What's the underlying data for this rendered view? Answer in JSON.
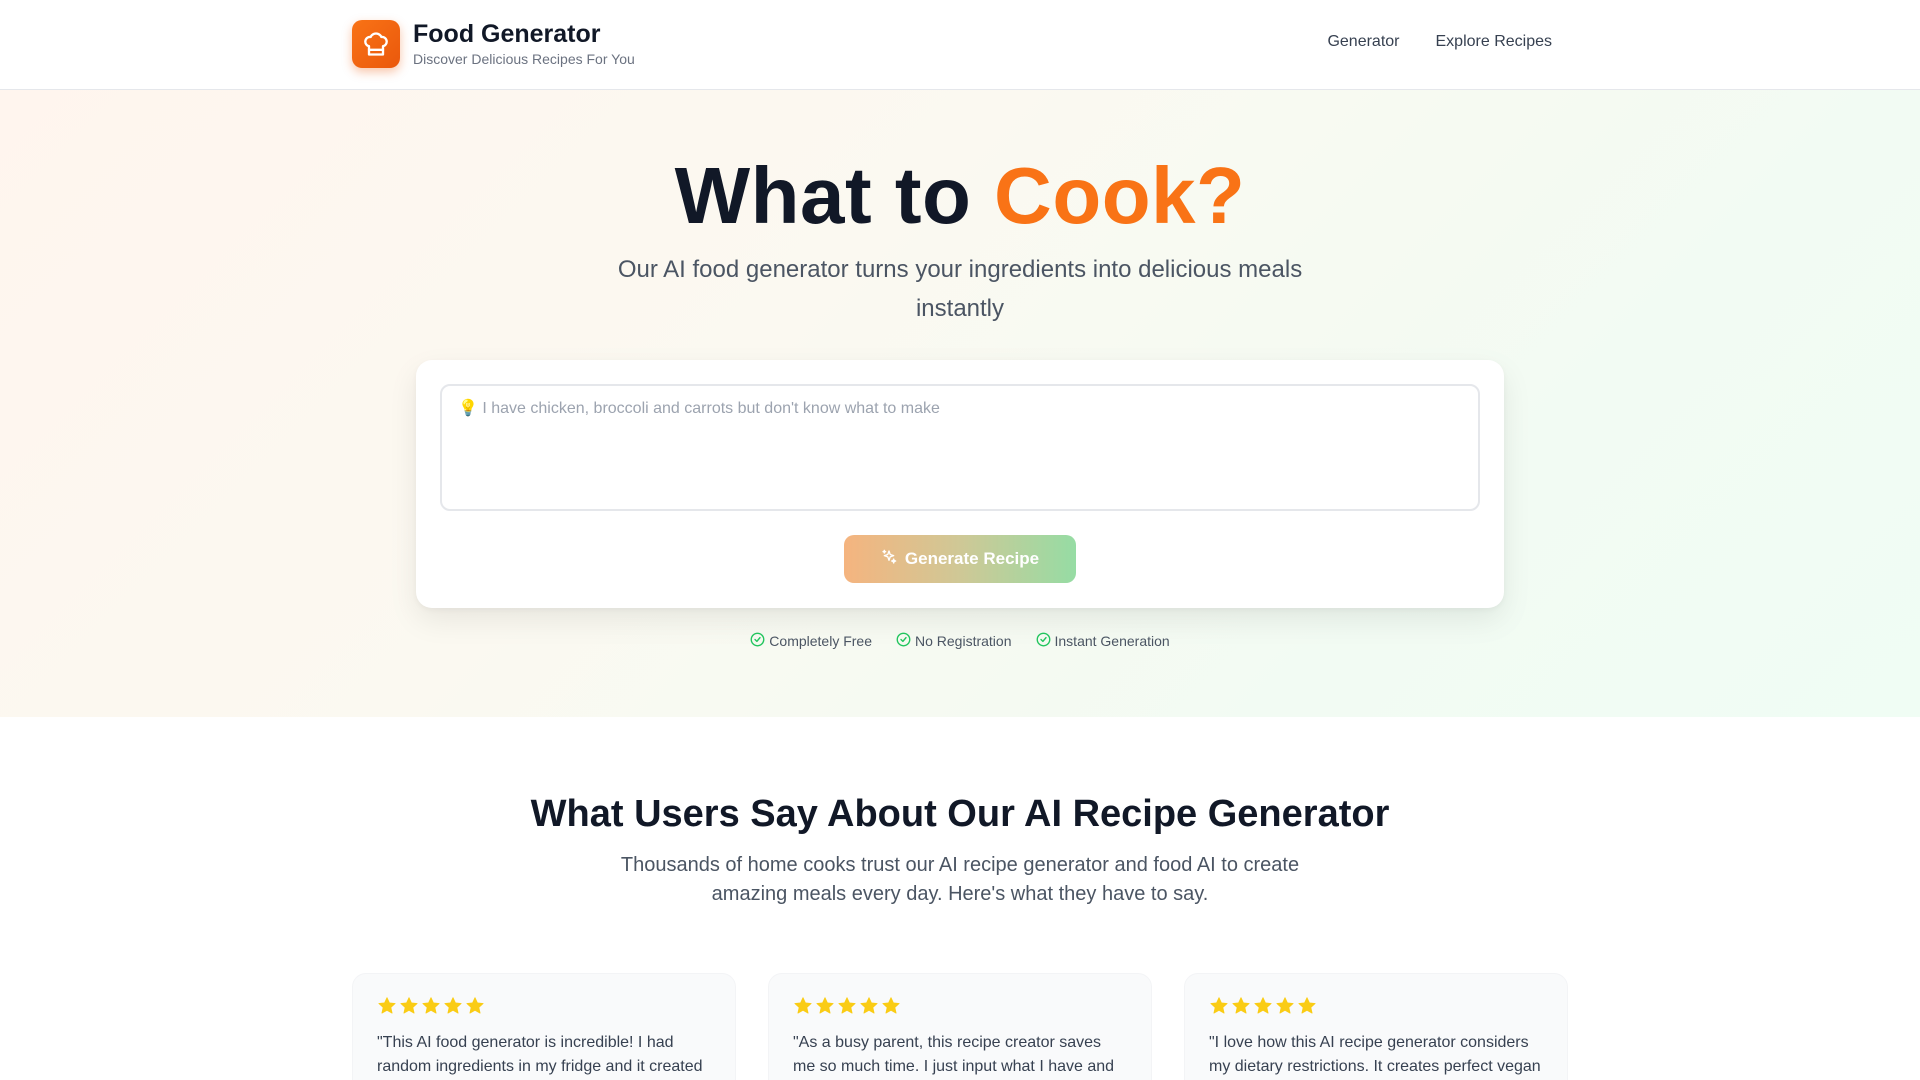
{
  "header": {
    "title": "Food Generator",
    "subtitle": "Discover Delicious Recipes For You",
    "nav": [
      "Generator",
      "Explore Recipes"
    ]
  },
  "hero": {
    "title_part1": "What to ",
    "title_accent": "Cook?",
    "subtitle": "Our AI food generator turns your ingredients into delicious meals instantly",
    "input_placeholder": "💡 I have chicken, broccoli and carrots but don't know what to make",
    "input_value": "",
    "generate_label": "Generate Recipe",
    "features": [
      "Completely Free",
      "No Registration",
      "Instant Generation"
    ]
  },
  "testimonials": {
    "title": "What Users Say About Our AI Recipe Generator",
    "subtitle": "Thousands of home cooks trust our AI recipe generator and food AI to create amazing meals every day. Here's what they have to say.",
    "items": [
      {
        "rating": 5,
        "text": "\"This AI food generator is incredible! I had random ingredients in my fridge and it created"
      },
      {
        "rating": 5,
        "text": "\"As a busy parent, this recipe creator saves me so much time. I just input what I have and get"
      },
      {
        "rating": 5,
        "text": "\"I love how this AI recipe generator considers my dietary restrictions. It creates perfect vegan"
      }
    ]
  },
  "colors": {
    "brand": "#f97316",
    "star": "#facc15",
    "check": "#22c55e"
  },
  "icons": {
    "logo": "chef-hat-icon",
    "generate": "sparkles-icon",
    "feature": "check-circle-icon",
    "rating": "star-icon"
  }
}
